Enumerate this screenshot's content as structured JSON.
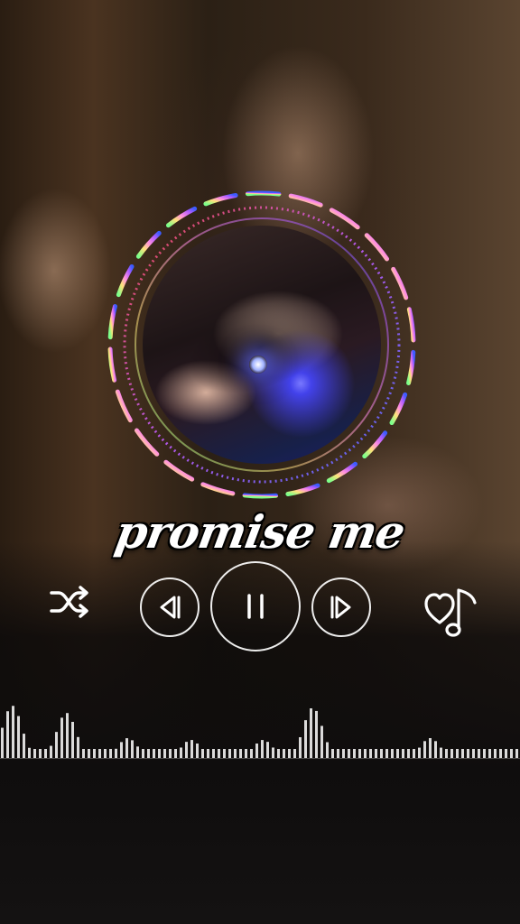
{
  "song": {
    "title": "promise me"
  },
  "playback": {
    "state": "playing"
  },
  "controls": {
    "shuffle_icon": "shuffle-icon",
    "prev_icon": "skip-previous-icon",
    "play_pause_icon": "pause-icon",
    "next_icon": "skip-next-icon",
    "favorite_icon": "heart-music-note-icon"
  },
  "colors": {
    "control_stroke": "#ffffff",
    "ring_gradient": [
      "#7cff8a",
      "#ffe27a",
      "#ff6fd0",
      "#b25cff",
      "#3b5bff"
    ],
    "center_glow": "#6f7dff"
  }
}
